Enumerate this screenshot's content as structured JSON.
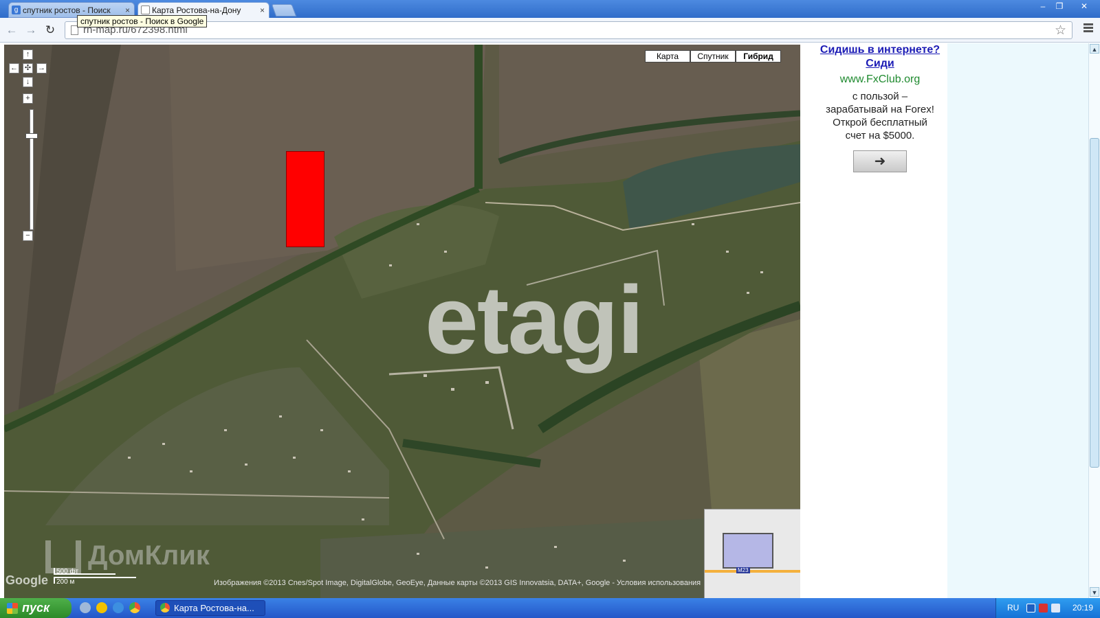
{
  "browser": {
    "tabs": [
      {
        "title": "спутник ростов - Поиск",
        "icon": "google-icon",
        "active": false
      },
      {
        "title": "Карта Ростова-на-Дону",
        "icon": "page-icon",
        "active": true
      }
    ],
    "tooltip": "спутник ростов - Поиск в Google",
    "url": "rn-map.ru/672398.html",
    "close_symbol": "×",
    "icons": [
      "back-arrow-icon",
      "forward-arrow-icon",
      "reload-icon",
      "star-icon",
      "menu-icon"
    ]
  },
  "map": {
    "type_buttons": [
      "Карта",
      "Спутник",
      "Гибрид"
    ],
    "selected_type": "Гибрид",
    "pan_up": "↑",
    "pan_down": "↓",
    "pan_left": "←",
    "pan_right": "→",
    "pan_center": "✣",
    "zoom_in": "+",
    "zoom_out": "−",
    "zoom_level_fraction": 0.8,
    "watermark_etagi": "etagi",
    "watermark_domclick": "ДомКлик",
    "google_logo": "Google",
    "scale_ft": "500 фт",
    "scale_m": "200 м",
    "attribution": "Изображения ©2013 Cnes/Spot Image, DigitalGlobe, GeoEye, Данные карты ©2013 GIS Innovatsia, DATA+, Google - Условия использования",
    "overview_road_label": "M23",
    "highlight_color": "#ff0000"
  },
  "ad": {
    "title": "Сидишь в интернете? Сиди",
    "url": "www.FxClub.org",
    "text": "с пользой – зарабатывай на Forex! Открой бесплатный счет на $5000.",
    "button_icon": "➜"
  },
  "taskbar": {
    "start_label": "пуск",
    "task_item": "Карта Ростова-на...",
    "language": "RU",
    "clock": "20:19"
  }
}
